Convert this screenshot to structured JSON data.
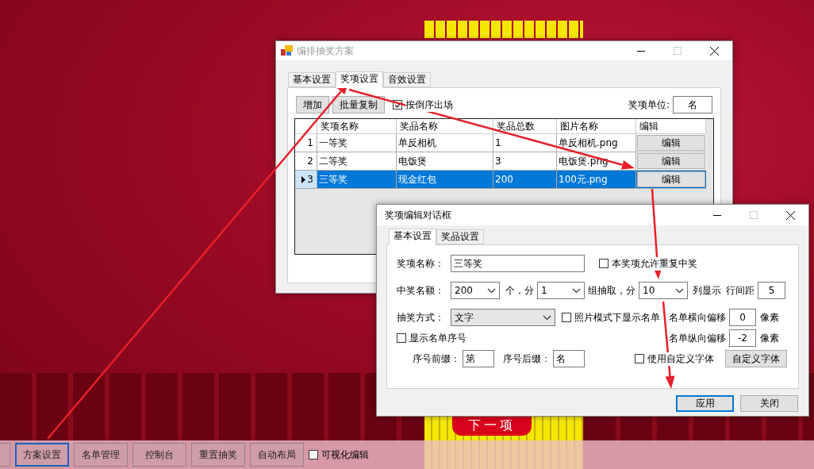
{
  "main_window": {
    "title": "编排抽奖方案",
    "tabs": [
      {
        "label": "基本设置",
        "selected": false
      },
      {
        "label": "奖项设置",
        "selected": true
      },
      {
        "label": "音效设置",
        "selected": false
      }
    ],
    "buttons": [
      "增加",
      "批量复制"
    ],
    "reverse_order": {
      "label": "按倒序出场",
      "checked": true
    },
    "unit": {
      "label": "奖项单位:",
      "value": "名"
    },
    "grid": {
      "columns": [
        "奖项名称",
        "奖品名称",
        "奖品总数",
        "图片名称",
        "编辑"
      ],
      "rows": [
        {
          "index": "1",
          "cells": [
            "一等奖",
            "单反相机",
            "1",
            "单反相机.png"
          ],
          "button": "编辑",
          "selected": false
        },
        {
          "index": "2",
          "cells": [
            "二等奖",
            "电饭煲",
            "3",
            "电饭煲.png"
          ],
          "button": "编辑",
          "selected": false
        },
        {
          "index": "3",
          "cells": [
            "三等奖",
            "现金红包",
            "200",
            "100元.png"
          ],
          "button": "编辑",
          "selected": true
        }
      ]
    }
  },
  "dialog": {
    "title": "奖项编辑对话框",
    "tabs": [
      {
        "label": "基本设置",
        "selected": true
      },
      {
        "label": "奖品设置",
        "selected": false
      }
    ],
    "name": {
      "label": "奖项名称：",
      "value": "三等奖"
    },
    "allow_repeat": {
      "label": "本奖项允许重复中奖",
      "checked": false
    },
    "quota": {
      "label": "中奖名额：",
      "value": "200"
    },
    "quota_sep": "个，分",
    "groups": {
      "value": "1"
    },
    "groups_sep": "组抽取，分",
    "columns": {
      "value": "10"
    },
    "columns_suffix": "列显示",
    "line_spacing": {
      "label": "行间距",
      "value": "5"
    },
    "mode": {
      "label": "抽奖方式：",
      "value": "文字"
    },
    "photo_show_list": {
      "label": "照片模式下显示名单",
      "checked": false
    },
    "h_offset": {
      "label": "名单横向偏移",
      "value": "0",
      "unit": "像素"
    },
    "show_index": {
      "label": "显示名单序号",
      "checked": false
    },
    "v_offset": {
      "label": "名单纵向偏移",
      "value": "-2",
      "unit": "像素"
    },
    "prefix": {
      "label": "序号前缀：",
      "value": "第"
    },
    "suffix": {
      "label": "序号后缀：",
      "value": "名"
    },
    "custom_font": {
      "label": "使用自定义字体",
      "checked": false
    },
    "font_button": "自定义字体",
    "buttons": [
      {
        "label": "应用",
        "default": true
      },
      {
        "label": "关闭",
        "default": false
      }
    ]
  },
  "next_button": {
    "label": "下一项"
  },
  "toolbar": {
    "buttons": [
      {
        "label": "方案设置",
        "focused": true
      },
      {
        "label": "名单管理",
        "focused": false
      },
      {
        "label": "控制台",
        "focused": false
      },
      {
        "label": "重置抽奖",
        "focused": false
      },
      {
        "label": "自动布局",
        "focused": false
      }
    ],
    "visual_edit": {
      "label": "可视化编辑",
      "checked": false
    }
  }
}
